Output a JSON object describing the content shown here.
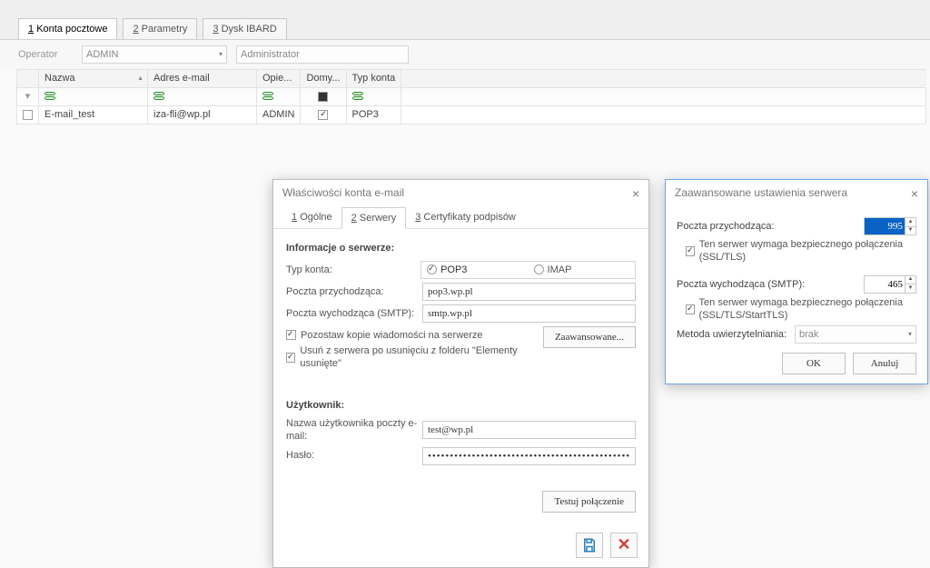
{
  "top_tabs": [
    {
      "num": "1",
      "label": "Konta pocztowe",
      "active": true
    },
    {
      "num": "2",
      "label": "Parametry",
      "active": false
    },
    {
      "num": "3",
      "label": "Dysk IBARD",
      "active": false
    }
  ],
  "operator": {
    "label": "Operator",
    "value": "ADMIN",
    "readonly": "Administrator"
  },
  "grid": {
    "cols": [
      "Nazwa",
      "Adres e-mail",
      "Opie...",
      "Domy...",
      "Typ konta"
    ],
    "row": {
      "name": "E-mail_test",
      "email": "iza-fli@wp.pl",
      "opiekun": "ADMIN",
      "domyslne": true,
      "typ": "POP3"
    }
  },
  "dlg1": {
    "title": "Właściwości konta e-mail",
    "tabs": [
      {
        "n": "1",
        "l": "Ogólne"
      },
      {
        "n": "2",
        "l": "Serwery"
      },
      {
        "n": "3",
        "l": "Certyfikaty podpisów"
      }
    ],
    "sec1": "Informacje o serwerze:",
    "typ_label": "Typ konta:",
    "typ_opts": [
      "POP3",
      "IMAP"
    ],
    "in_lbl": "Poczta przychodząca:",
    "in_val": "pop3.wp.pl",
    "out_lbl": "Poczta wychodząca (SMTP):",
    "out_val": "smtp.wp.pl",
    "ck1": "Pozostaw kopie wiadomości na serwerze",
    "ck2": "Usuń z serwera po usunięciu z folderu \"Elementy usunięte\"",
    "adv_btn": "Zaawansowane...",
    "sec2": "Użytkownik:",
    "user_lbl": "Nazwa użytkownika poczty e-mail:",
    "user_val": "test@wp.pl",
    "pass_lbl": "Hasło:",
    "pass_val": "••••••••••••••••••••••••••••••••••••••••••••••••••••••••",
    "test_btn": "Testuj połączenie"
  },
  "dlg2": {
    "title": "Zaawansowane ustawienia serwera",
    "in_lbl": "Poczta przychodząca:",
    "in_port": "995",
    "in_ssl": "Ten serwer wymaga bezpiecznego połączenia (SSL/TLS)",
    "out_lbl": "Poczta wychodząca (SMTP):",
    "out_port": "465",
    "out_ssl": "Ten serwer wymaga bezpiecznego połączenia (SSL/TLS/StartTLS)",
    "auth_lbl": "Metoda uwierzytelniania:",
    "auth_val": "brak",
    "ok": "OK",
    "cancel": "Anuluj"
  }
}
